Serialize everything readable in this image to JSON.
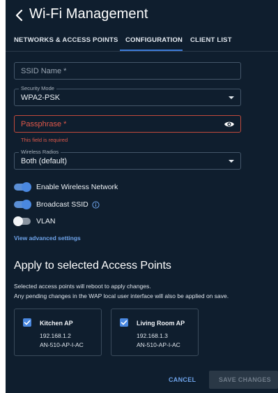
{
  "header": {
    "title": "Wi-Fi Management"
  },
  "tabs": [
    {
      "label": "NETWORKS & ACCESS POINTS",
      "active": false
    },
    {
      "label": "CONFIGURATION",
      "active": true
    },
    {
      "label": "CLIENT LIST",
      "active": false
    }
  ],
  "form": {
    "ssid": {
      "placeholder": "SSID Name *",
      "value": ""
    },
    "security_mode": {
      "label": "Security Mode",
      "value": "WPA2-PSK"
    },
    "passphrase": {
      "placeholder": "Passphrase *",
      "value": "",
      "error": "This field is required"
    },
    "wireless_radios": {
      "label": "Wireless Radios",
      "value": "Both (default)"
    }
  },
  "toggles": [
    {
      "label": "Enable Wireless Network",
      "on": true
    },
    {
      "label": "Broadcast SSID",
      "on": true
    },
    {
      "label": "VLAN",
      "on": false
    }
  ],
  "advanced_link": "View advanced settings",
  "apply_section": {
    "title": "Apply to selected Access Points",
    "line1": "Selected access points will reboot to apply changes.",
    "line2": "Any pending changes in the WAP local user interface will also be applied on save."
  },
  "access_points": [
    {
      "name": "Kitchen AP",
      "ip": "192.168.1.2",
      "model": "AN-510-AP-I-AC",
      "checked": true
    },
    {
      "name": "Living Room AP",
      "ip": "192.168.1.3",
      "model": "AN-510-AP-I-AC",
      "checked": true
    }
  ],
  "footer": {
    "cancel_label": "CANCEL",
    "save_label": "SAVE CHANGES"
  },
  "colors": {
    "background": "#0f1e2e",
    "accent": "#4a88e0",
    "error": "#e0584a",
    "link": "#6ea3ea"
  }
}
